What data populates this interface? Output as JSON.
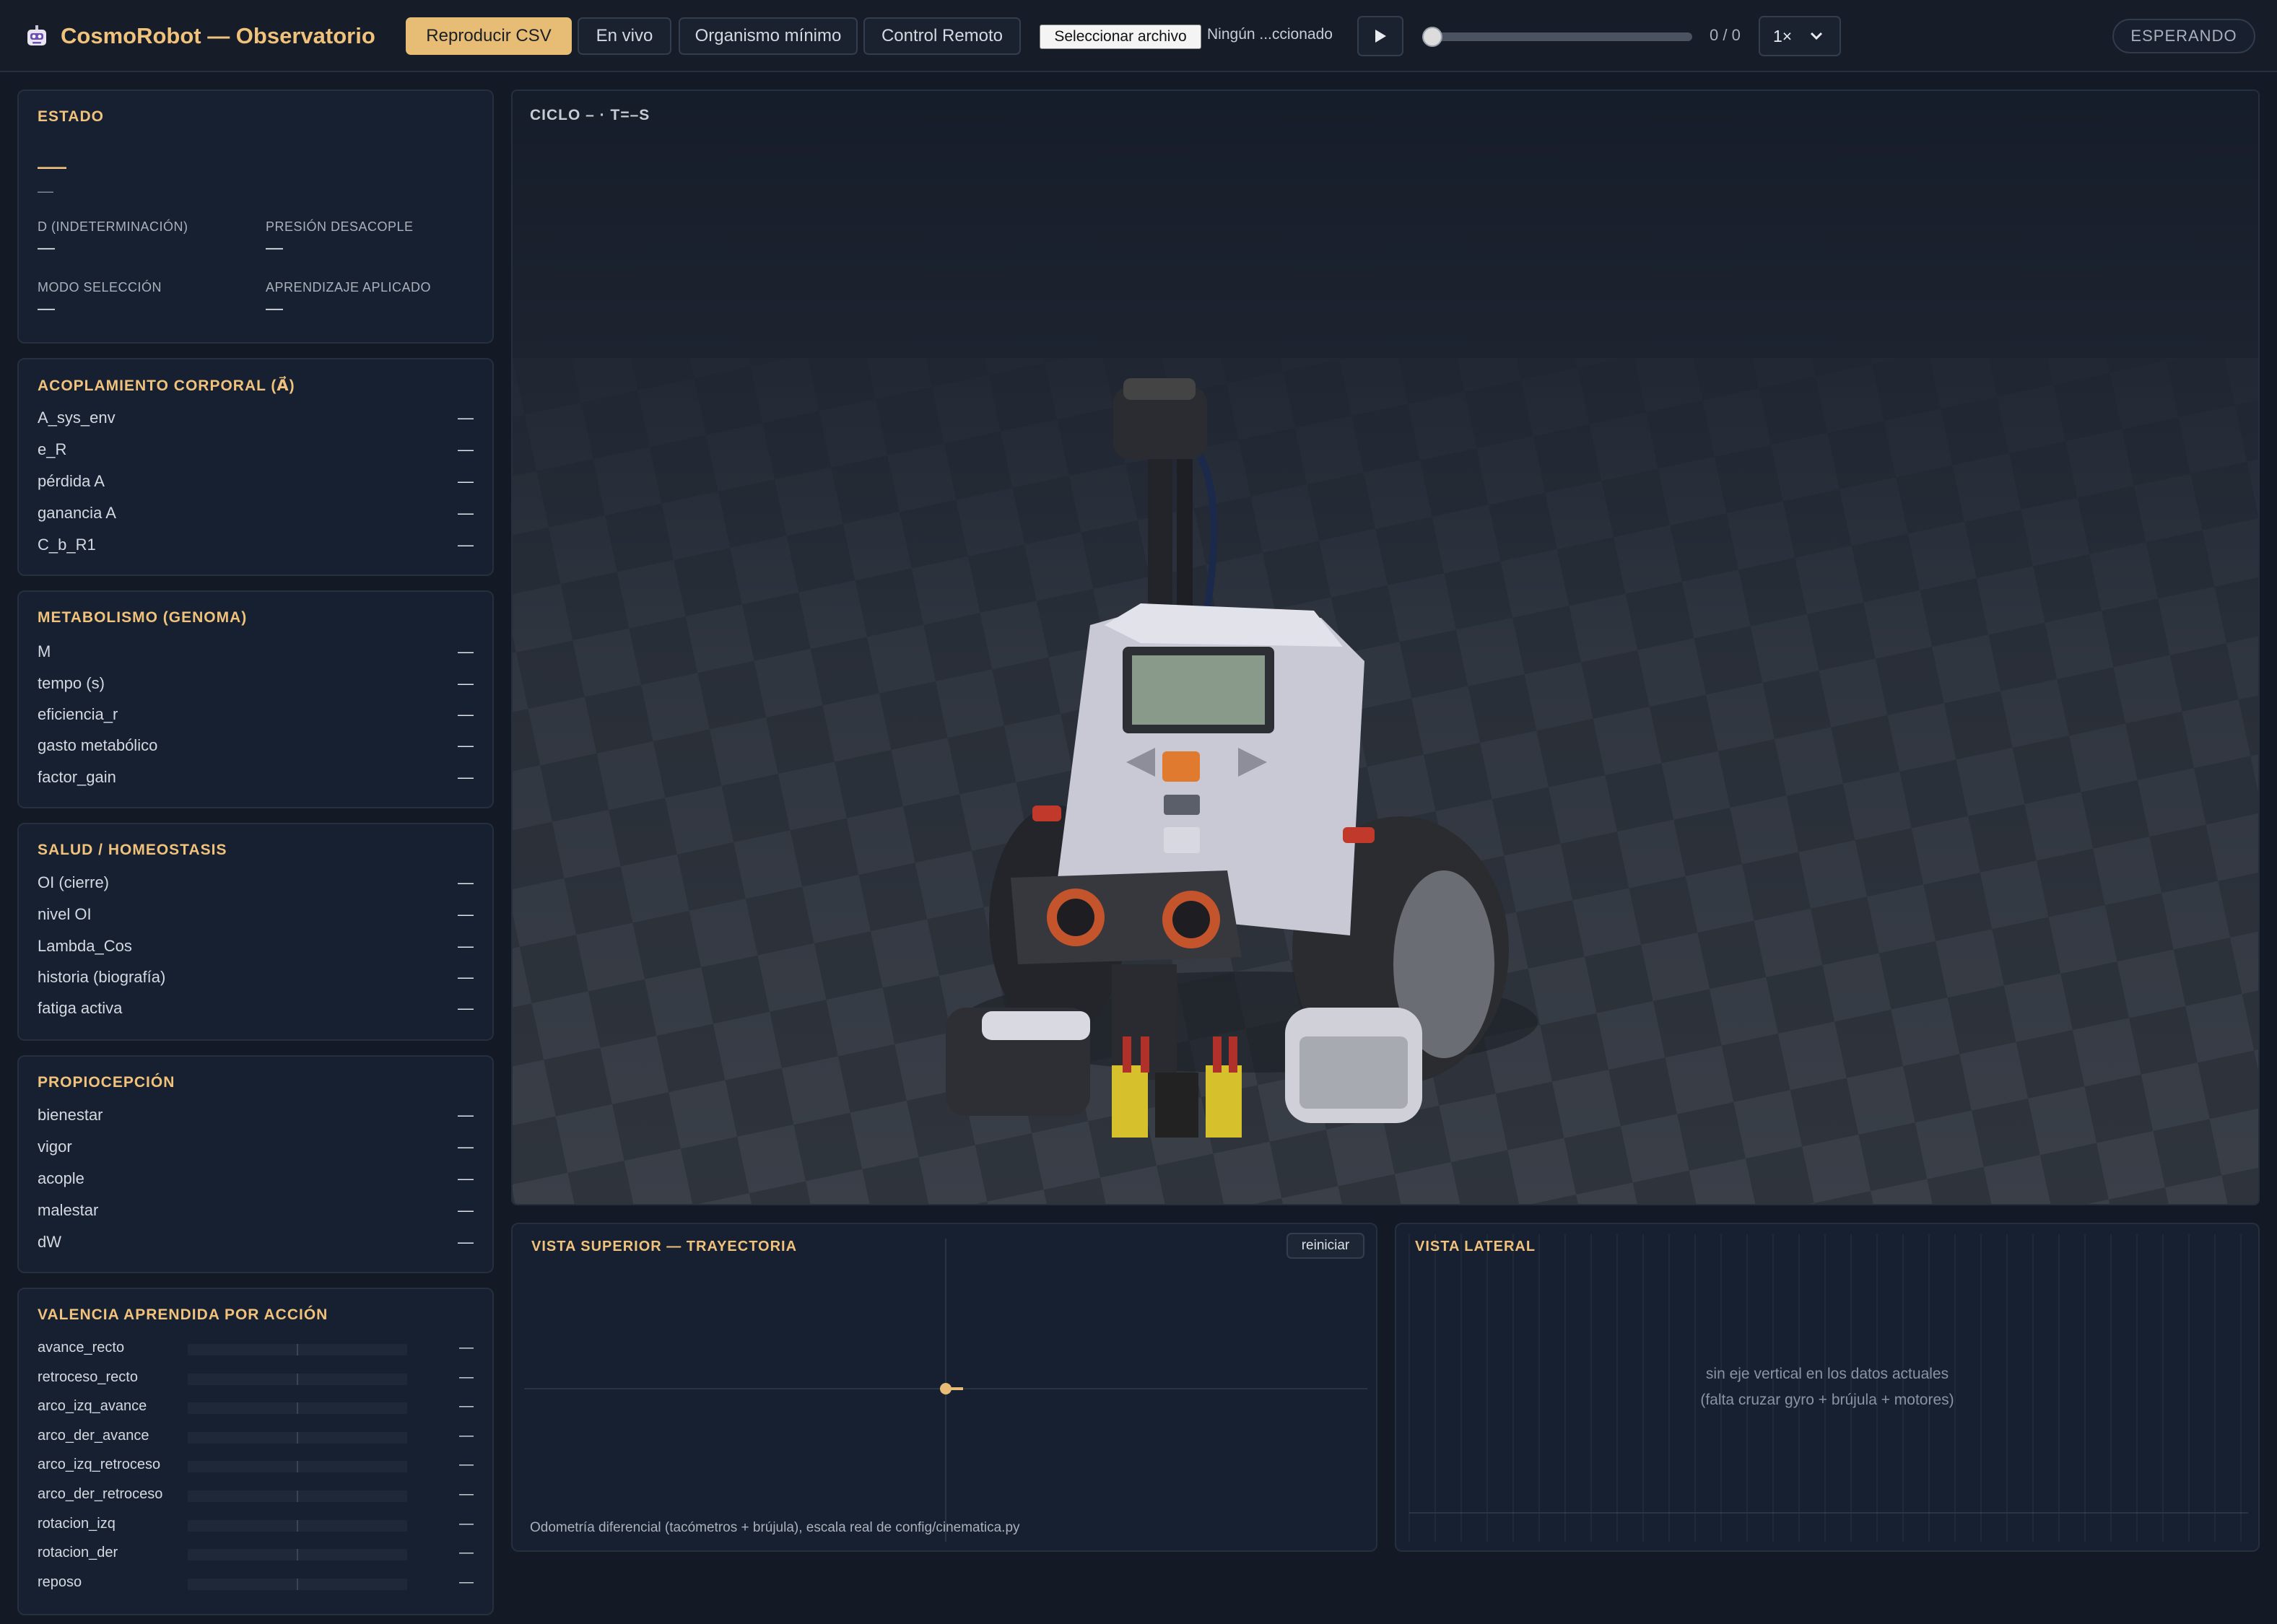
{
  "header": {
    "title": "CosmoRobot — Observatorio",
    "tabs": [
      {
        "label": "Reproducir CSV",
        "active": true
      },
      {
        "label": "En vivo"
      },
      {
        "label": "Organismo mínimo"
      },
      {
        "label": "Control Remoto"
      }
    ],
    "file_button": "Seleccionar archivo",
    "file_status": "Ningún ...ccionado",
    "counter": "0 / 0",
    "playback_progress": 0,
    "speed": "1×",
    "status": "ESPERANDO"
  },
  "estado": {
    "title": "ESTADO",
    "main_value": "—",
    "sub_value": "—",
    "fields": [
      {
        "label": "D (INDETERMINACIÓN)",
        "value": "—"
      },
      {
        "label": "PRESIÓN DESACOPLE",
        "value": "—"
      },
      {
        "label": "MODO SELECCIÓN",
        "value": "—"
      },
      {
        "label": "APRENDIZAJE APLICADO",
        "value": "—"
      }
    ]
  },
  "acoplamiento": {
    "title": "ACOPLAMIENTO CORPORAL (A⃗)",
    "rows": [
      {
        "label": "A_sys_env",
        "value": "—"
      },
      {
        "label": "e_R",
        "value": "—"
      },
      {
        "label": "pérdida A",
        "value": "—"
      },
      {
        "label": "ganancia A",
        "value": "—"
      },
      {
        "label": "C_b_R1",
        "value": "—"
      }
    ]
  },
  "metabolismo": {
    "title": "METABOLISMO (GENOMA)",
    "rows": [
      {
        "label": "M",
        "value": "—"
      },
      {
        "label": "tempo (s)",
        "value": "—"
      },
      {
        "label": "eficiencia_r",
        "value": "—"
      },
      {
        "label": "gasto metabólico",
        "value": "—"
      },
      {
        "label": "factor_gain",
        "value": "—"
      }
    ]
  },
  "salud": {
    "title": "SALUD / HOMEOSTASIS",
    "rows": [
      {
        "label": "OI (cierre)",
        "value": "—"
      },
      {
        "label": "nivel OI",
        "value": "—"
      },
      {
        "label": "Lambda_Cos",
        "value": "—"
      },
      {
        "label": "historia (biografía)",
        "value": "—"
      },
      {
        "label": "fatiga activa",
        "value": "—"
      }
    ]
  },
  "propiocepcion": {
    "title": "PROPIOCEPCIÓN",
    "rows": [
      {
        "label": "bienestar",
        "value": "—"
      },
      {
        "label": "vigor",
        "value": "—"
      },
      {
        "label": "acople",
        "value": "—"
      },
      {
        "label": "malestar",
        "value": "—"
      },
      {
        "label": "dW",
        "value": "—"
      }
    ]
  },
  "valencia": {
    "title": "VALENCIA APRENDIDA POR ACCIÓN",
    "rows": [
      {
        "label": "avance_recto",
        "value": "—"
      },
      {
        "label": "retroceso_recto",
        "value": "—"
      },
      {
        "label": "arco_izq_avance",
        "value": "—"
      },
      {
        "label": "arco_der_avance",
        "value": "—"
      },
      {
        "label": "arco_izq_retroceso",
        "value": "—"
      },
      {
        "label": "arco_der_retroceso",
        "value": "—"
      },
      {
        "label": "rotacion_izq",
        "value": "—"
      },
      {
        "label": "rotacion_der",
        "value": "—"
      },
      {
        "label": "reposo",
        "value": "—"
      }
    ]
  },
  "view3d": {
    "cycle_label": "CICLO – · T=–S"
  },
  "top_view": {
    "title": "VISTA SUPERIOR — TRAYECTORIA",
    "reset_label": "reiniciar",
    "caption": "Odometría diferencial (tacómetros + brújula), escala real de config/cinematica.py"
  },
  "side_view": {
    "title": "VISTA LATERAL",
    "message_line1": "sin eje vertical en los datos actuales",
    "message_line2": "(falta cruzar gyro + brújula + motores)"
  },
  "colors": {
    "accent": "#f0c27b",
    "background": "#131a26",
    "panel": "#172030"
  }
}
